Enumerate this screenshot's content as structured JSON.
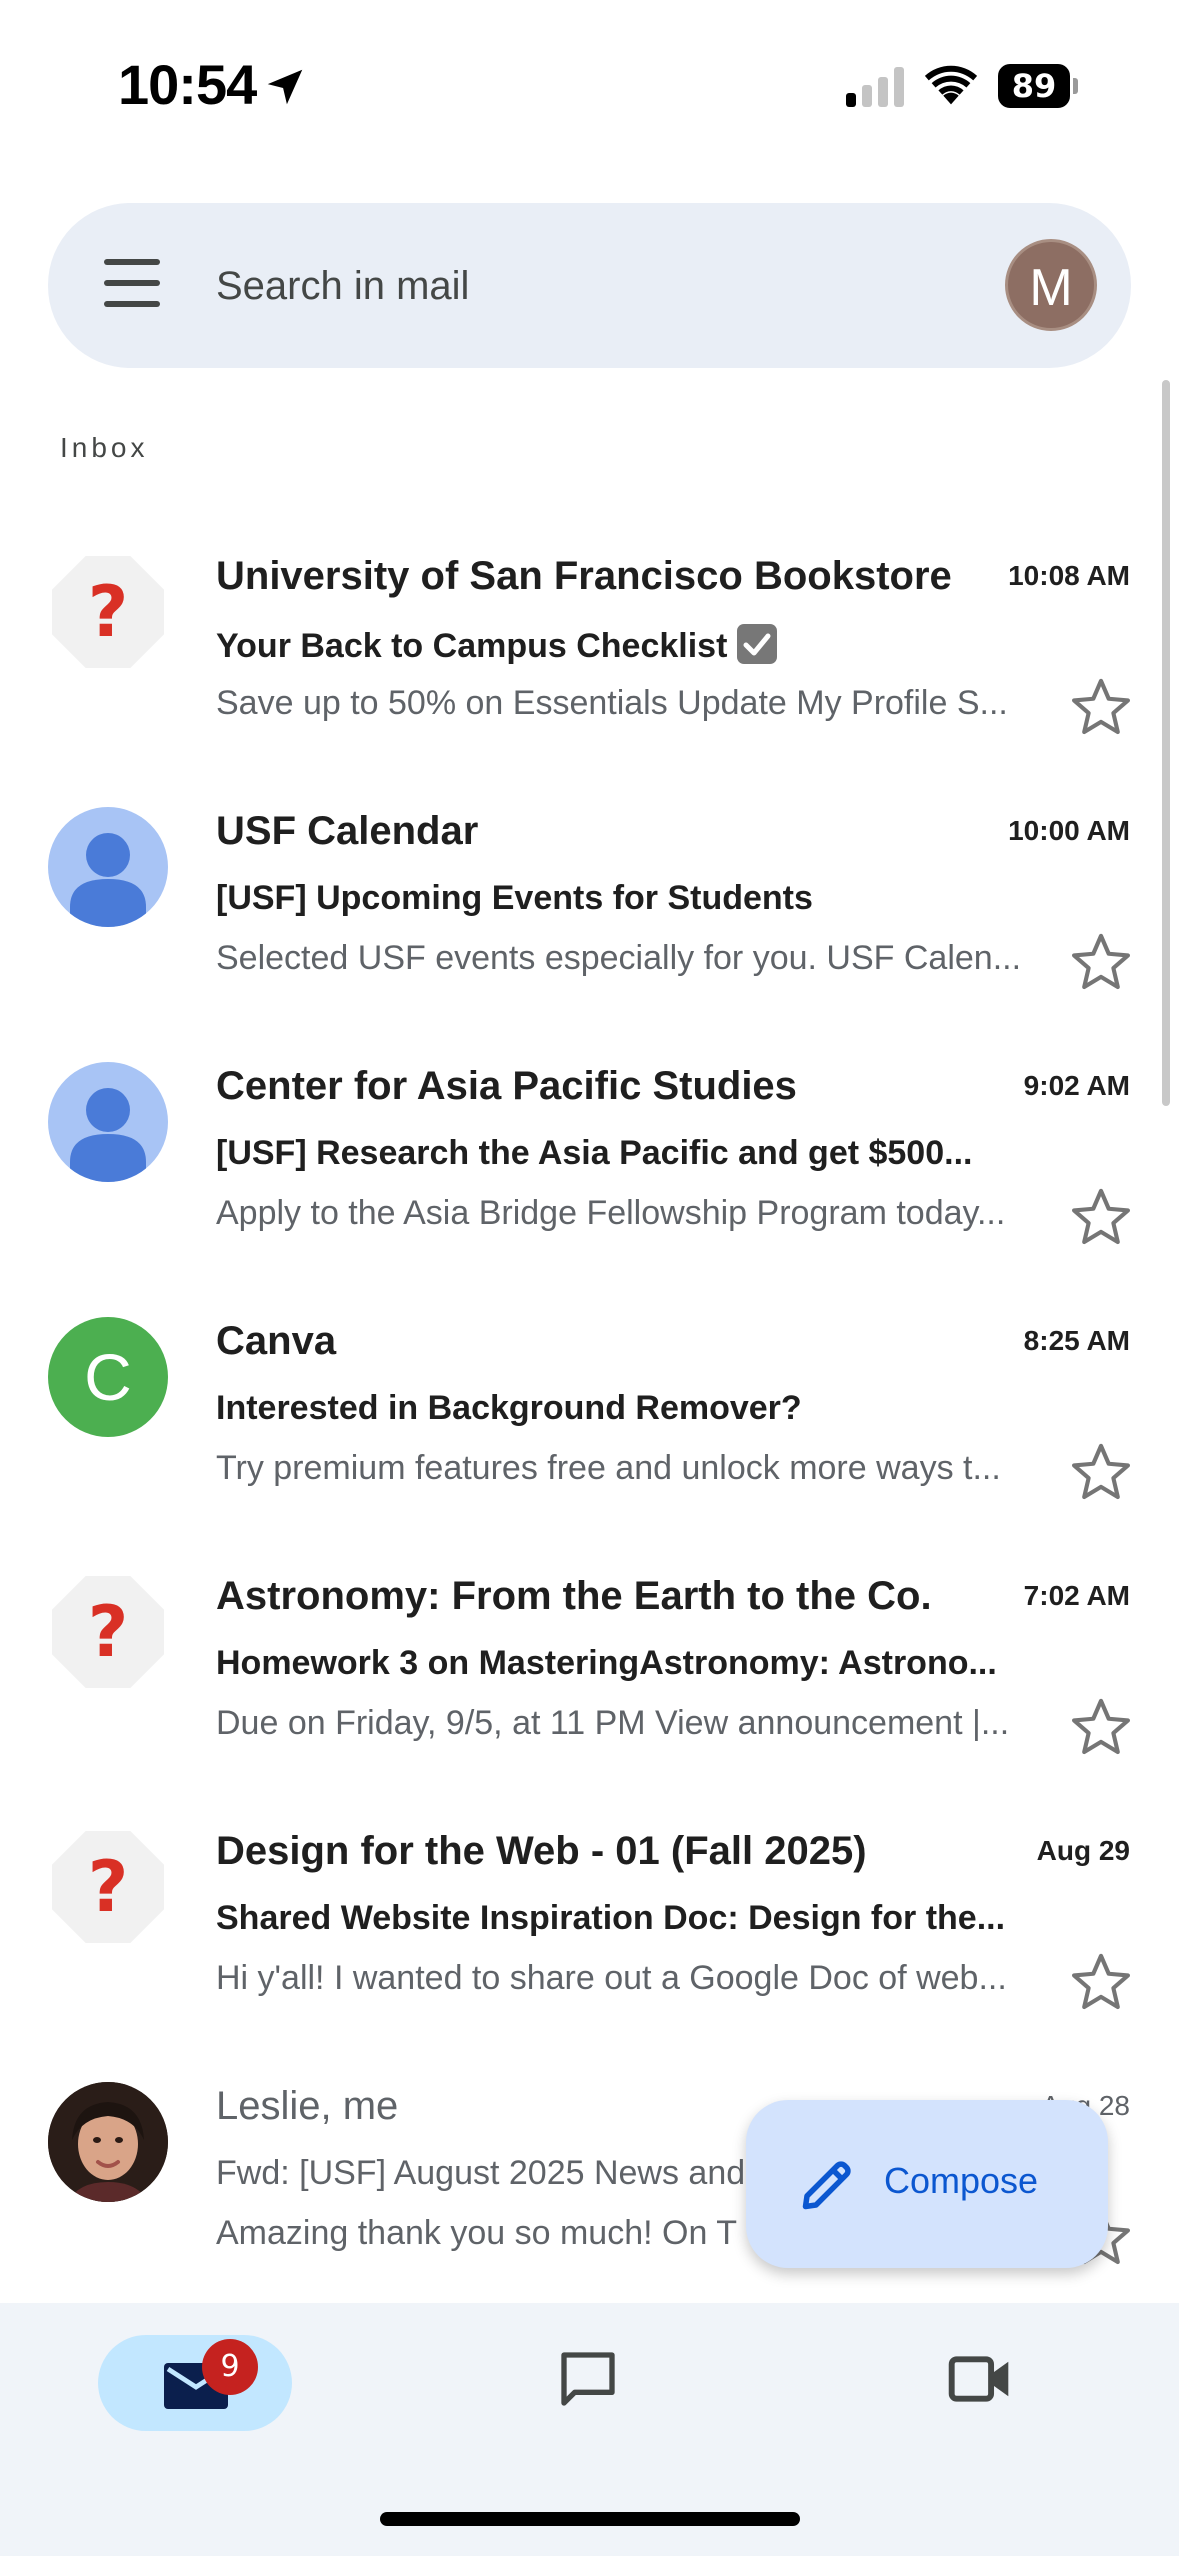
{
  "status_bar": {
    "time": "10:54",
    "battery": "89"
  },
  "search": {
    "placeholder": "Search in mail",
    "account_initial": "M"
  },
  "section_label": "Inbox",
  "emails": [
    {
      "sender": "University of San Francisco Bookstore",
      "time": "10:08 AM",
      "subject": "Your Back to Campus Checklist",
      "snippet": "Save up to 50% on Essentials Update My Profile S...",
      "avatar": "unknown-sender-icon",
      "unread": true
    },
    {
      "sender": "USF Calendar",
      "time": "10:00 AM",
      "subject": "[USF] Upcoming Events for Students",
      "snippet": "Selected USF events especially for you. USF Calen...",
      "avatar": "person-icon",
      "unread": true
    },
    {
      "sender": "Center for Asia Pacific Studies",
      "time": "9:02 AM",
      "subject": "[USF] Research the Asia Pacific and get $500...",
      "snippet": "Apply to the Asia Bridge Fellowship Program today...",
      "avatar": "person-icon",
      "unread": true
    },
    {
      "sender": "Canva",
      "time": "8:25 AM",
      "subject": "Interested in Background Remover?",
      "snippet": "Try premium features free and unlock more ways t...",
      "avatar_letter": "C",
      "unread": true
    },
    {
      "sender": "Astronomy: From the Earth to the Co.",
      "time": "7:02 AM",
      "subject": "Homework 3 on MasteringAstronomy: Astrono...",
      "snippet": "Due on Friday, 9/5, at 11 PM View announcement |...",
      "avatar": "unknown-sender-icon",
      "unread": true
    },
    {
      "sender": "Design for the Web - 01 (Fall 2025)",
      "time": "Aug 29",
      "subject": "Shared Website Inspiration Doc: Design for the...",
      "snippet": "Hi y'all! I wanted to share out a Google Doc of web...",
      "avatar": "unknown-sender-icon",
      "unread": true
    },
    {
      "sender": "Leslie, me",
      "time": "Aug 28",
      "subject": "Fwd: [USF] August 2025 News and",
      "snippet": "Amazing thank you so much! On T",
      "avatar": "photo",
      "unread": false
    }
  ],
  "compose": {
    "label": "Compose"
  },
  "bottom_nav": {
    "mail_badge": "9"
  },
  "colors": {
    "accent": "#0b57d0",
    "search_bg": "#e9eef6",
    "badge": "#c5221f"
  }
}
